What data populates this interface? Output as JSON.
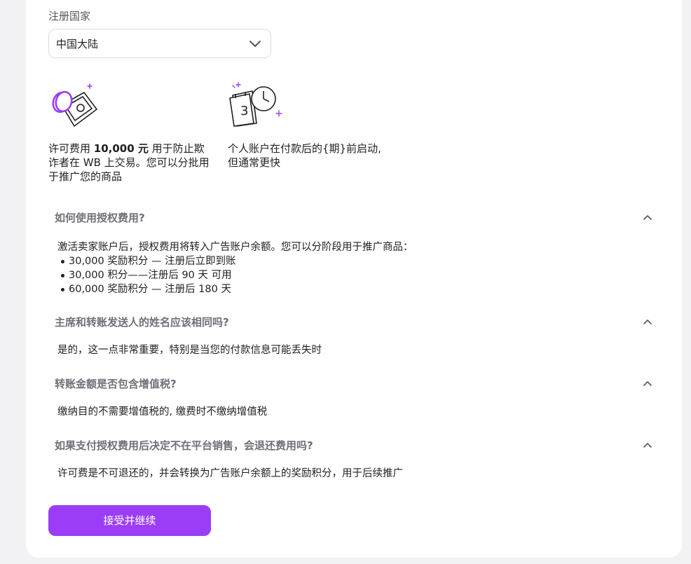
{
  "form": {
    "country_label": "注册国家",
    "country_value": "中国大陆"
  },
  "info": [
    {
      "icon": "money-coin-icon",
      "text_before": "许可费用 ",
      "text_bold": "10,000 元",
      "text_after": " 用于防止欺诈者在 WB 上交易。您可以分批用于推广您的商品"
    },
    {
      "icon": "calendar-clock-icon",
      "text": "个人账户在付款后的{期}前启动,但通常更快"
    }
  ],
  "faq": [
    {
      "question": "如何使用授权费用?",
      "answer": "激活卖家账户后，授权费用将转入广告账户余额。您可以分阶段用于推广商品：",
      "bullets": [
        "30,000 奖励积分 — 注册后立即到账",
        "30,000 积分——注册后 90 天 可用",
        "60,000 奖励积分 — 注册后 180 天"
      ]
    },
    {
      "question": "主席和转账发送人的姓名应该相同吗?",
      "answer": "是的，这一点非常重要，特别是当您的付款信息可能丢失时"
    },
    {
      "question": "转账金额是否包含增值税?",
      "answer": "缴纳目的不需要增值税的, 缴费时不缴纳增值税"
    },
    {
      "question": "如果支付授权费用后决定不在平台销售，会退还费用吗?",
      "answer": "许可费是不可退还的，并会转换为广告账户余额上的奖励积分，用于后续推广"
    }
  ],
  "actions": {
    "accept_label": "接受并继续"
  },
  "colors": {
    "accent": "#9b3df6",
    "question_text": "#6f6f78"
  }
}
